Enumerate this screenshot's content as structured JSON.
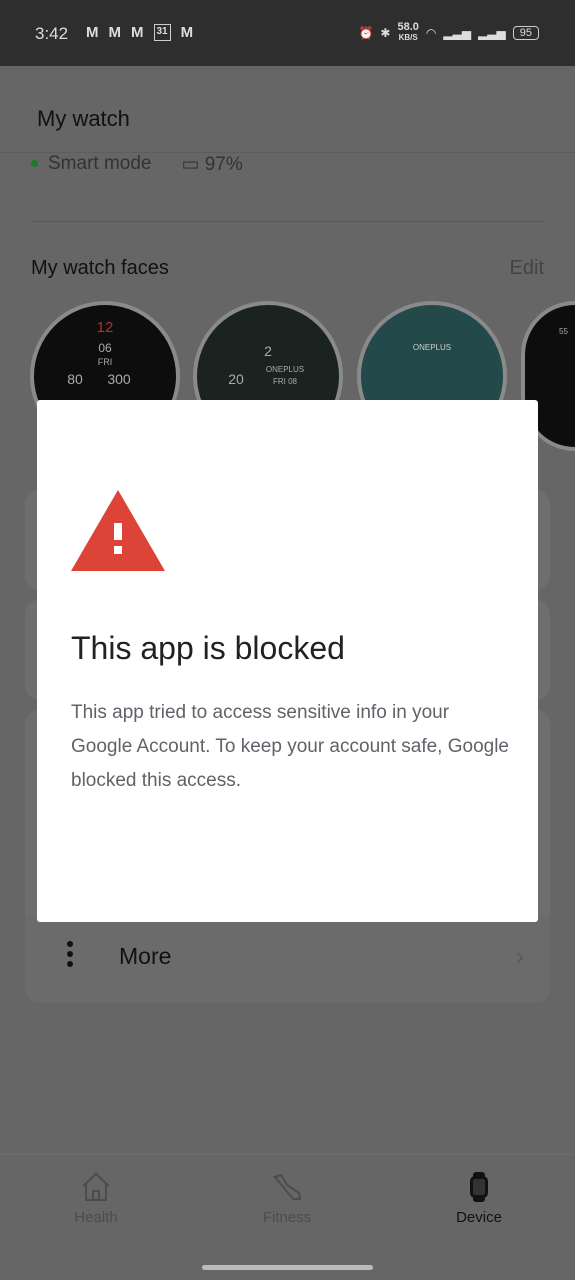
{
  "status_bar": {
    "time": "3:42",
    "notifications": [
      "M",
      "M",
      "M",
      "31",
      "M"
    ],
    "speed": "58.0",
    "speed_unit": "KB/S",
    "battery": "95"
  },
  "header": {
    "title": "My watch"
  },
  "device": {
    "mode": "Smart mode",
    "battery": "97%"
  },
  "watch_faces": {
    "title": "My watch faces",
    "edit_label": "Edit",
    "faces": [
      {
        "top": "12",
        "mid": "06",
        "day": "FRI",
        "left": "80",
        "right": "300"
      },
      {
        "top": "2",
        "mid": "ONEPLUS",
        "day": "FRI 08",
        "left": "20",
        "right": ""
      },
      {
        "top": "ONEPLUS",
        "mid": "",
        "day": "",
        "left": "",
        "right": ""
      },
      {
        "top": "55",
        "mid": "",
        "day": "",
        "left": "",
        "right": ""
      }
    ]
  },
  "more": {
    "label": "More"
  },
  "dialog": {
    "title": "This app is blocked",
    "body": "This app tried to access sensitive info in your Google Account. To keep your account safe, Google blocked this access.",
    "warning_color": "#db4437"
  },
  "bottom_nav": {
    "tabs": [
      {
        "label": "Health",
        "icon": "home-icon"
      },
      {
        "label": "Fitness",
        "icon": "shoe-icon"
      },
      {
        "label": "Device",
        "icon": "watch-icon",
        "active": true
      }
    ]
  }
}
